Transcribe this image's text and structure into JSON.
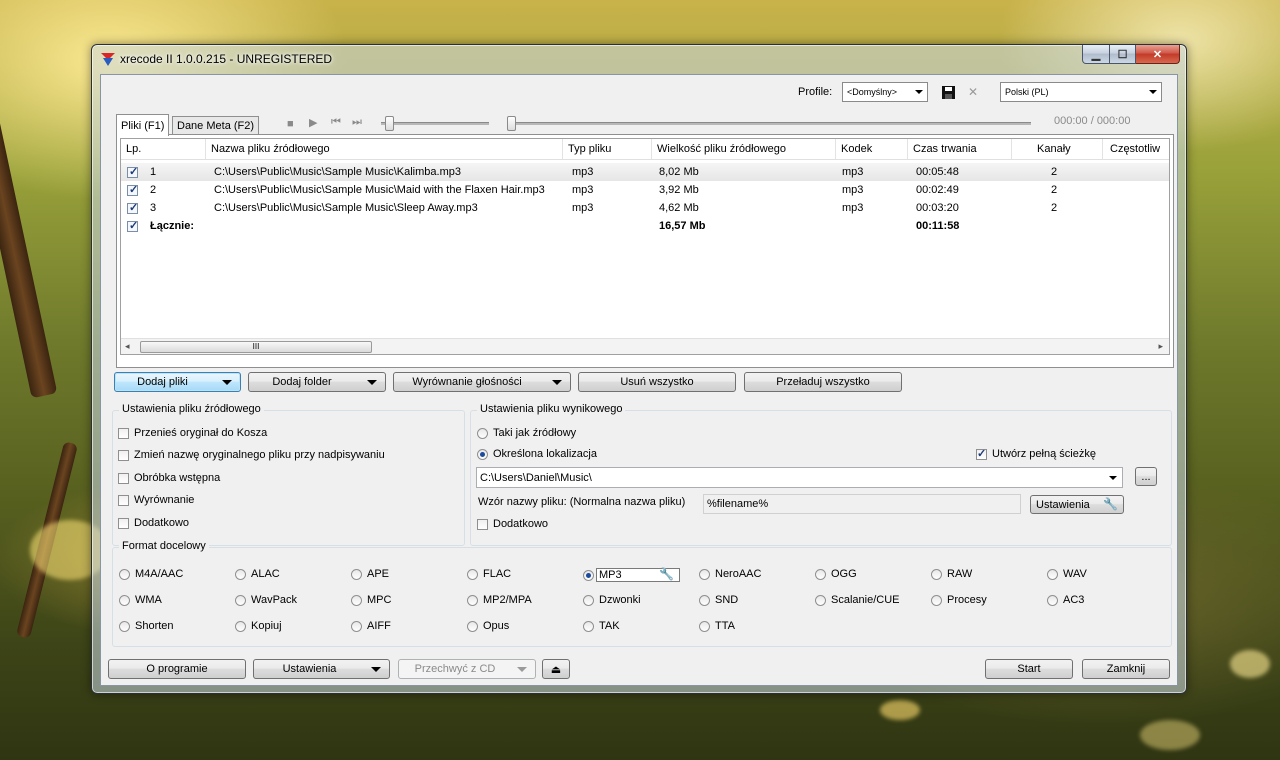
{
  "window": {
    "title": "xrecode II 1.0.0.215 - UNREGISTERED"
  },
  "profile": {
    "label": "Profile:",
    "value": "<Domyślny>",
    "language": "Polski (PL)"
  },
  "tabs": [
    {
      "label": "Pliki (F1)"
    },
    {
      "label": "Dane Meta (F2)"
    }
  ],
  "player": {
    "time": "000:00 / 000:00"
  },
  "table": {
    "columns": [
      "Lp.",
      "Nazwa pliku źródłowego",
      "Typ pliku",
      "Wielkość pliku źródłowego",
      "Kodek",
      "Czas trwania",
      "Kanały",
      "Częstotliw"
    ],
    "rows": [
      {
        "checked": true,
        "num": "1",
        "name": "C:\\Users\\Public\\Music\\Sample Music\\Kalimba.mp3",
        "type": "mp3",
        "size": "8,02 Mb",
        "codec": "mp3",
        "duration": "00:05:48",
        "channels": "2"
      },
      {
        "checked": true,
        "num": "2",
        "name": "C:\\Users\\Public\\Music\\Sample Music\\Maid with the Flaxen Hair.mp3",
        "type": "mp3",
        "size": "3,92 Mb",
        "codec": "mp3",
        "duration": "00:02:49",
        "channels": "2"
      },
      {
        "checked": true,
        "num": "3",
        "name": "C:\\Users\\Public\\Music\\Sample Music\\Sleep Away.mp3",
        "type": "mp3",
        "size": "4,62 Mb",
        "codec": "mp3",
        "duration": "00:03:20",
        "channels": "2"
      }
    ],
    "total": {
      "label": "Łącznie:",
      "size": "16,57 Mb",
      "duration": "00:11:58"
    },
    "scroll_grip": "III"
  },
  "actions": {
    "add_files": "Dodaj pliki",
    "add_folder": "Dodaj folder",
    "normalize": "Wyrównanie głośności",
    "remove_all": "Usuń wszystko",
    "reload_all": "Przeładuj wszystko"
  },
  "source_settings": {
    "title": "Ustawienia pliku źródłowego",
    "options": [
      {
        "label": "Przenieś oryginał do Kosza",
        "checked": false
      },
      {
        "label": "Zmień nazwę oryginalnego pliku przy nadpisywaniu",
        "checked": false
      },
      {
        "label": "Obróbka wstępna",
        "checked": false
      },
      {
        "label": "Wyrównanie",
        "checked": false
      },
      {
        "label": "Dodatkowo",
        "checked": false
      }
    ]
  },
  "output_settings": {
    "title": "Ustawienia pliku wynikowego",
    "same_as_source": "Taki jak źródłowy",
    "specific_location": "Określona lokalizacja",
    "create_full_path": "Utwórz pełną ścieżkę",
    "path": "C:\\Users\\Daniel\\Music\\",
    "browse": "...",
    "pattern_label": "Wzór nazwy pliku: (Normalna nazwa pliku)",
    "pattern_value": "%filename%",
    "settings_btn": "Ustawienia",
    "extra": "Dodatkowo"
  },
  "format": {
    "title": "Format docelowy",
    "selected": "MP3",
    "options": [
      [
        "M4A/AAC",
        "ALAC",
        "APE",
        "FLAC",
        "MP3",
        "NeroAAC",
        "OGG",
        "RAW",
        "WAV"
      ],
      [
        "WMA",
        "WavPack",
        "MPC",
        "MP2/MPA",
        "Dzwonki",
        "SND",
        "Scalanie/CUE",
        "Procesy",
        "AC3"
      ],
      [
        "Shorten",
        "Kopiuj",
        "AIFF",
        "Opus",
        "TAK",
        "TTA"
      ]
    ]
  },
  "bottom": {
    "about": "O programie",
    "settings": "Ustawienia",
    "rip_cd": "Przechwyć z CD",
    "start": "Start",
    "close": "Zamknij"
  },
  "colors": {
    "accent": "#3c7fb1",
    "radio_dot": "#1c4a9c",
    "close_button": "#c23a28"
  }
}
